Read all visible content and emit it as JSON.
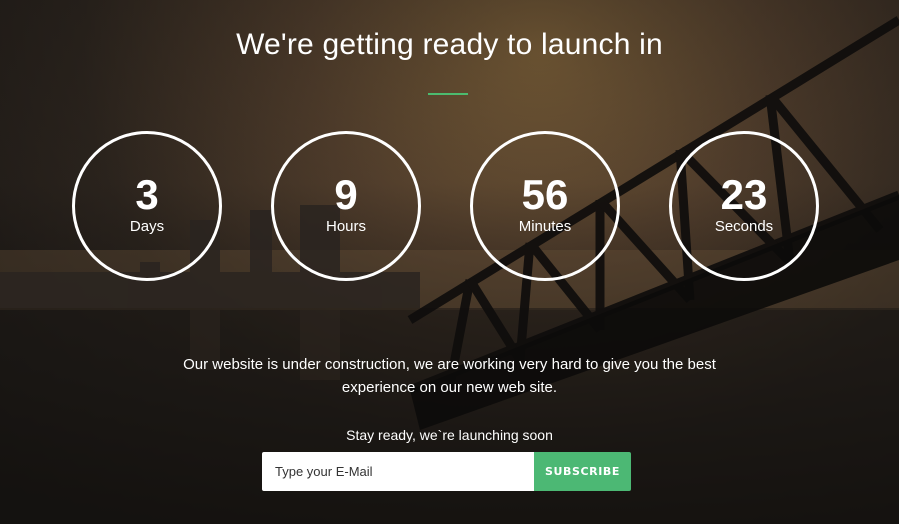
{
  "hero": {
    "title": "We're getting ready to launch in",
    "accent_color": "#4cbb6f"
  },
  "countdown": [
    {
      "value": "3",
      "unit": "Days"
    },
    {
      "value": "9",
      "unit": "Hours"
    },
    {
      "value": "56",
      "unit": "Minutes"
    },
    {
      "value": "23",
      "unit": "Seconds"
    }
  ],
  "description": "Our website is under construction, we are working very hard to give you the best experience on our new web site.",
  "subscribe": {
    "tagline": "Stay ready, we`re launching soon",
    "email_placeholder": "Type your E-Mail",
    "button_label": "SUBSCRIBE",
    "button_color": "#4cb874"
  }
}
